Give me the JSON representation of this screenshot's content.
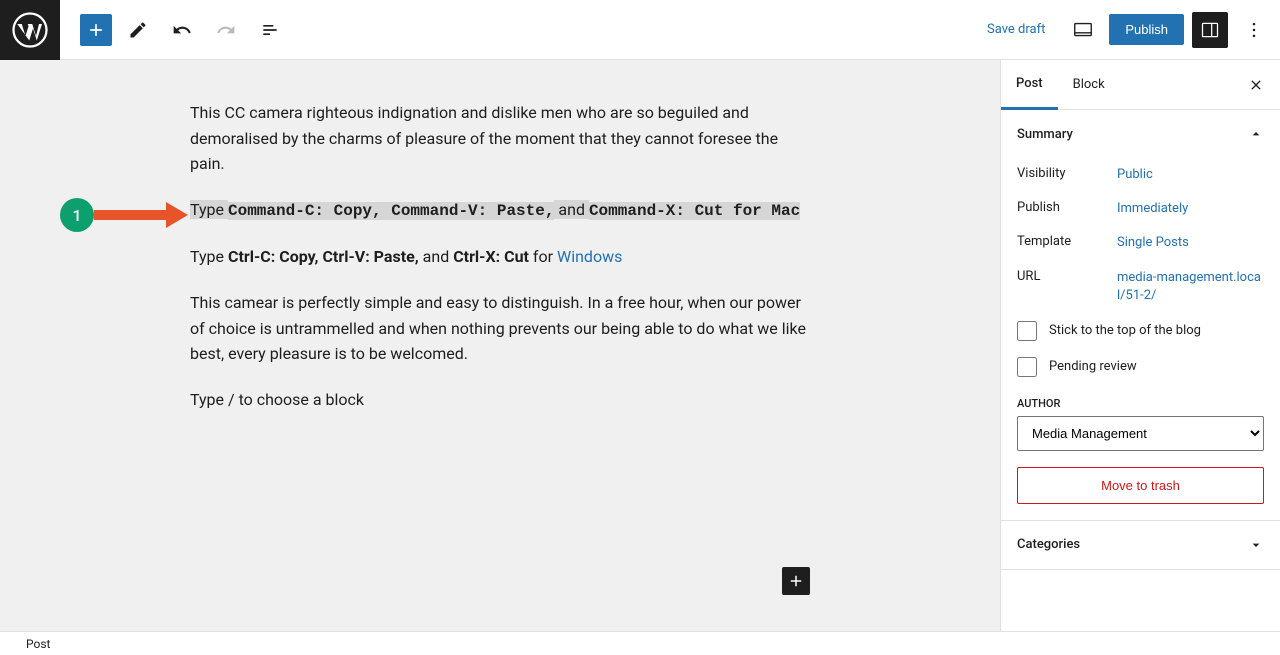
{
  "toolbar": {
    "save_draft": "Save draft",
    "publish": "Publish"
  },
  "annotation": {
    "number": "1"
  },
  "content": {
    "p1": "This CC camera righteous indignation and dislike men who are so beguiled and demoralised by the charms of pleasure of the moment that they cannot foresee the pain.",
    "p2_a": "Type ",
    "p2_b": "Command-C: Copy, Command-V: Paste,",
    "p2_c": " and ",
    "p2_d": "Command-X: Cut for Mac",
    "p3_a": "Type ",
    "p3_b": "Ctrl-C: Copy, Ctrl-V: Paste,",
    "p3_c": " and ",
    "p3_d": "Ctrl-X: Cut",
    "p3_e": " for ",
    "p3_link": "Windows",
    "p4": "This camear is perfectly simple and easy to distinguish. In a free hour, when our power of choice is untrammelled and when nothing prevents our being able to do what we like best, every pleasure is to be welcomed.",
    "placeholder": "Type / to choose a block"
  },
  "sidebar": {
    "tabs": {
      "post": "Post",
      "block": "Block"
    },
    "summary": {
      "title": "Summary",
      "visibility_label": "Visibility",
      "visibility_value": "Public",
      "publish_label": "Publish",
      "publish_value": "Immediately",
      "template_label": "Template",
      "template_value": "Single Posts",
      "url_label": "URL",
      "url_value": "media-management.local/51-2/",
      "stick": "Stick to the top of the blog",
      "pending": "Pending review",
      "author_label": "AUTHOR",
      "author_value": "Media Management",
      "trash": "Move to trash"
    },
    "categories": {
      "title": "Categories"
    }
  },
  "footer": {
    "breadcrumb": "Post"
  }
}
